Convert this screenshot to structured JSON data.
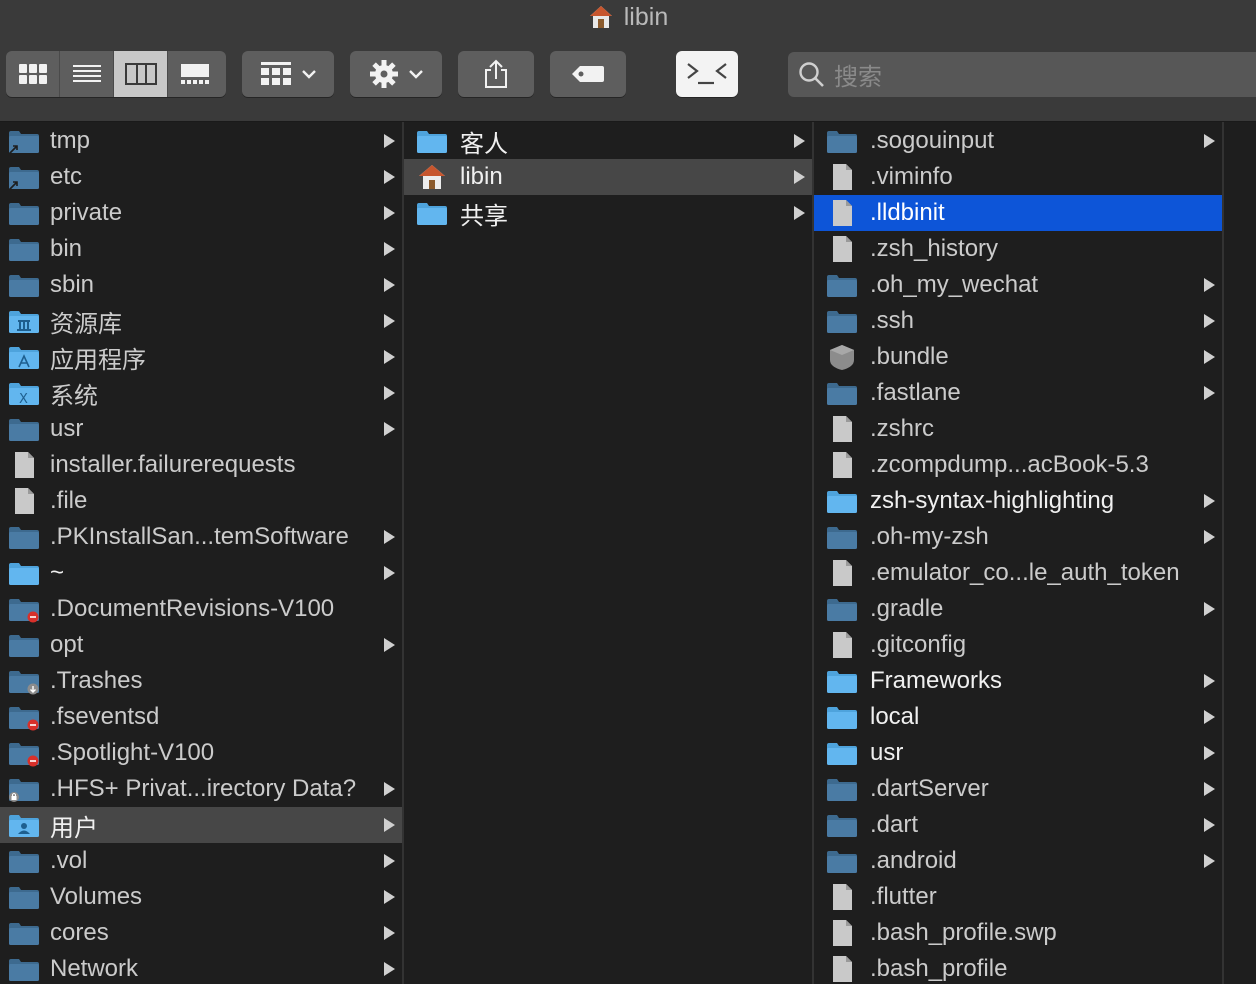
{
  "window": {
    "title": "libin",
    "title_icon": "home-icon"
  },
  "toolbar": {
    "view_modes": [
      "icon-view",
      "list-view",
      "column-view",
      "gallery-view"
    ],
    "active_view": "column-view",
    "group_button": "group-by-icon",
    "action_button": "gear-icon",
    "share_button": "share-icon",
    "tag_button": "tag-icon",
    "terminal_button": "terminal-icon",
    "search_placeholder": "搜索"
  },
  "colors": {
    "selection_blue": "#0d55d8",
    "selection_gray": "#474747",
    "folder_dim": "#4a7ba4",
    "folder_bright": "#62b6ef",
    "background": "#1e1e1e",
    "toolbar": "#3a3a3a"
  },
  "columns": [
    {
      "name": "root",
      "items": [
        {
          "label": "tmp",
          "kind": "folder-alias",
          "chevron": true
        },
        {
          "label": "etc",
          "kind": "folder-alias",
          "chevron": true
        },
        {
          "label": "private",
          "kind": "folder",
          "chevron": true
        },
        {
          "label": "bin",
          "kind": "folder",
          "chevron": true
        },
        {
          "label": "sbin",
          "kind": "folder",
          "chevron": true
        },
        {
          "label": "资源库",
          "kind": "library",
          "chevron": true
        },
        {
          "label": "应用程序",
          "kind": "applications",
          "chevron": true
        },
        {
          "label": "系统",
          "kind": "system",
          "chevron": true
        },
        {
          "label": "usr",
          "kind": "folder",
          "chevron": true
        },
        {
          "label": "installer.failurerequests",
          "kind": "file",
          "chevron": false
        },
        {
          "label": ".file",
          "kind": "file",
          "chevron": false
        },
        {
          "label": ".PKInstallSan...temSoftware",
          "kind": "folder",
          "chevron": true
        },
        {
          "label": "~",
          "kind": "folder-bright",
          "chevron": true
        },
        {
          "label": ".DocumentRevisions-V100",
          "kind": "folder-restricted",
          "chevron": false
        },
        {
          "label": "opt",
          "kind": "folder",
          "chevron": true
        },
        {
          "label": ".Trashes",
          "kind": "folder-dropbox",
          "chevron": false
        },
        {
          "label": ".fseventsd",
          "kind": "folder-restricted",
          "chevron": false
        },
        {
          "label": ".Spotlight-V100",
          "kind": "folder-restricted",
          "chevron": false
        },
        {
          "label": ".HFS+ Privat...irectory Data?",
          "kind": "folder-locked",
          "chevron": true
        },
        {
          "label": "用户",
          "kind": "users",
          "chevron": true,
          "selected": "gray"
        },
        {
          "label": ".vol",
          "kind": "folder",
          "chevron": true
        },
        {
          "label": "Volumes",
          "kind": "folder",
          "chevron": true
        },
        {
          "label": "cores",
          "kind": "folder",
          "chevron": true
        },
        {
          "label": "Network",
          "kind": "folder",
          "chevron": true
        }
      ]
    },
    {
      "name": "users",
      "items": [
        {
          "label": "客人",
          "kind": "folder-bright",
          "chevron": true
        },
        {
          "label": "libin",
          "kind": "home",
          "chevron": true,
          "selected": "gray"
        },
        {
          "label": "共享",
          "kind": "folder-bright",
          "chevron": true
        }
      ]
    },
    {
      "name": "libin",
      "items": [
        {
          "label": ".sogouinput",
          "kind": "folder",
          "chevron": true
        },
        {
          "label": ".viminfo",
          "kind": "file",
          "chevron": false
        },
        {
          "label": ".lldbinit",
          "kind": "file",
          "chevron": false,
          "selected": "blue"
        },
        {
          "label": ".zsh_history",
          "kind": "file",
          "chevron": false
        },
        {
          "label": ".oh_my_wechat",
          "kind": "folder",
          "chevron": true
        },
        {
          "label": ".ssh",
          "kind": "folder",
          "chevron": true
        },
        {
          "label": ".bundle",
          "kind": "bundle",
          "chevron": true
        },
        {
          "label": ".fastlane",
          "kind": "folder",
          "chevron": true
        },
        {
          "label": ".zshrc",
          "kind": "file",
          "chevron": false
        },
        {
          "label": ".zcompdump...acBook-5.3",
          "kind": "file",
          "chevron": false
        },
        {
          "label": "zsh-syntax-highlighting",
          "kind": "folder-bright",
          "chevron": true
        },
        {
          "label": ".oh-my-zsh",
          "kind": "folder",
          "chevron": true
        },
        {
          "label": ".emulator_co...le_auth_token",
          "kind": "file",
          "chevron": false
        },
        {
          "label": ".gradle",
          "kind": "folder",
          "chevron": true
        },
        {
          "label": ".gitconfig",
          "kind": "file",
          "chevron": false
        },
        {
          "label": "Frameworks",
          "kind": "folder-bright",
          "chevron": true
        },
        {
          "label": "local",
          "kind": "folder-bright",
          "chevron": true
        },
        {
          "label": "usr",
          "kind": "folder-bright",
          "chevron": true
        },
        {
          "label": ".dartServer",
          "kind": "folder",
          "chevron": true
        },
        {
          "label": ".dart",
          "kind": "folder",
          "chevron": true
        },
        {
          "label": ".android",
          "kind": "folder",
          "chevron": true
        },
        {
          "label": ".flutter",
          "kind": "file",
          "chevron": false
        },
        {
          "label": ".bash_profile.swp",
          "kind": "file",
          "chevron": false
        },
        {
          "label": ".bash_profile",
          "kind": "file",
          "chevron": false
        }
      ]
    }
  ]
}
